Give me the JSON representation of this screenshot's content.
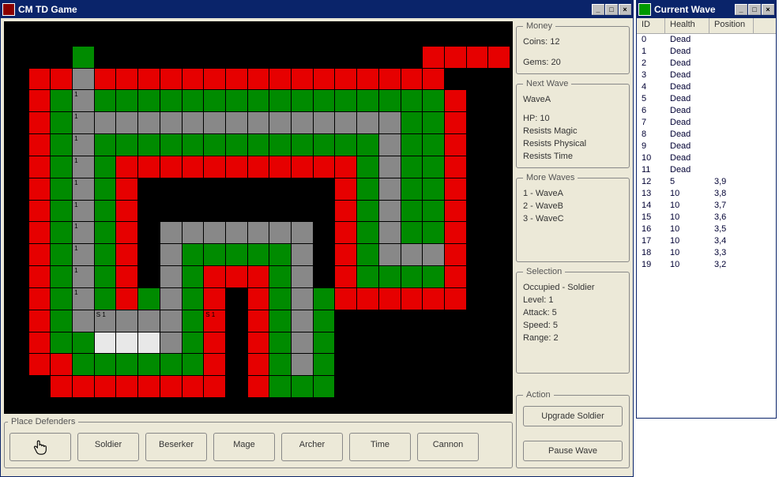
{
  "main_window": {
    "title": "CM TD Game"
  },
  "wave_window": {
    "title": "Current Wave"
  },
  "money": {
    "legend": "Money",
    "coins_label": "Coins: 12",
    "gems_label": "Gems: 20"
  },
  "next_wave": {
    "legend": "Next Wave",
    "name": "WaveA",
    "hp": "HP: 10",
    "r1": "Resists Magic",
    "r2": "Resists Physical",
    "r3": "Resists Time"
  },
  "more_waves": {
    "legend": "More Waves",
    "items": [
      "1 - WaveA",
      "2 - WaveB",
      "3 - WaveC"
    ]
  },
  "selection": {
    "legend": "Selection",
    "occ": "Occupied - Soldier",
    "level": "Level: 1",
    "attack": "Attack: 5",
    "speed": "Speed: 5",
    "range": "Range: 2"
  },
  "action": {
    "legend": "Action",
    "upgrade": "Upgrade Soldier",
    "pause": "Pause Wave"
  },
  "defenders": {
    "legend": "Place Defenders",
    "buttons": [
      "Soldier",
      "Beserker",
      "Mage",
      "Archer",
      "Time",
      "Cannon"
    ]
  },
  "wave_cols": {
    "id": "ID",
    "health": "Health",
    "pos": "Position"
  },
  "wave_rows": [
    {
      "id": "0",
      "health": "Dead",
      "pos": ""
    },
    {
      "id": "1",
      "health": "Dead",
      "pos": ""
    },
    {
      "id": "2",
      "health": "Dead",
      "pos": ""
    },
    {
      "id": "3",
      "health": "Dead",
      "pos": ""
    },
    {
      "id": "4",
      "health": "Dead",
      "pos": ""
    },
    {
      "id": "5",
      "health": "Dead",
      "pos": ""
    },
    {
      "id": "6",
      "health": "Dead",
      "pos": ""
    },
    {
      "id": "7",
      "health": "Dead",
      "pos": ""
    },
    {
      "id": "8",
      "health": "Dead",
      "pos": ""
    },
    {
      "id": "9",
      "health": "Dead",
      "pos": ""
    },
    {
      "id": "10",
      "health": "Dead",
      "pos": ""
    },
    {
      "id": "11",
      "health": "Dead",
      "pos": ""
    },
    {
      "id": "12",
      "health": "5",
      "pos": "3,9"
    },
    {
      "id": "13",
      "health": "10",
      "pos": "3,8"
    },
    {
      "id": "14",
      "health": "10",
      "pos": "3,7"
    },
    {
      "id": "15",
      "health": "10",
      "pos": "3,6"
    },
    {
      "id": "16",
      "health": "10",
      "pos": "3,5"
    },
    {
      "id": "17",
      "health": "10",
      "pos": "3,4"
    },
    {
      "id": "18",
      "health": "10",
      "pos": "3,3"
    },
    {
      "id": "19",
      "health": "10",
      "pos": "3,2"
    }
  ],
  "grid_layout": [
    "bbbbbbbbbbbbbbbbbbbbbbb",
    "bbbgbbbbbbbbbbbbbbbrrrr",
    "brrsrrrrrrrrrrrrrrrrbbb",
    "brgsggggggggggggggggrbb",
    "brgsssssssssssssssggrbb",
    "brgsgggggggggggggsggrbb",
    "brgsgrrrrrrrrrrrgsggrbb",
    "brgsgrbbbbbbbbbrgsggrbb",
    "brgsgrbbbbbbbbbrgsggrbb",
    "brgsgrbsssssssbrgsggrbb",
    "brgsgrbsgggggsbrgsssrbb",
    "brgsgrbsgrrrgsbrggggrbb",
    "brgsgrgsgrbrgsgrrrrrrbb",
    "brgsssssgrbrgsgbbbbbbbb",
    "brggwwwsgrbrgsgbbbbbbbb",
    "brrggggggrbrgsgbbbbbbbb",
    "bbrrrrrrrrbrgggbbbbbbbb"
  ],
  "grid_labels": [
    {
      "r": 3,
      "c": 3,
      "t": "1"
    },
    {
      "r": 4,
      "c": 3,
      "t": "1"
    },
    {
      "r": 5,
      "c": 3,
      "t": "1"
    },
    {
      "r": 6,
      "c": 3,
      "t": "1"
    },
    {
      "r": 7,
      "c": 3,
      "t": "1"
    },
    {
      "r": 8,
      "c": 3,
      "t": "1"
    },
    {
      "r": 9,
      "c": 3,
      "t": "1"
    },
    {
      "r": 10,
      "c": 3,
      "t": "1"
    },
    {
      "r": 11,
      "c": 3,
      "t": "1"
    },
    {
      "r": 12,
      "c": 3,
      "t": "1"
    },
    {
      "r": 13,
      "c": 4,
      "t": "S 1"
    },
    {
      "r": 13,
      "c": 9,
      "t": "S 1"
    }
  ]
}
